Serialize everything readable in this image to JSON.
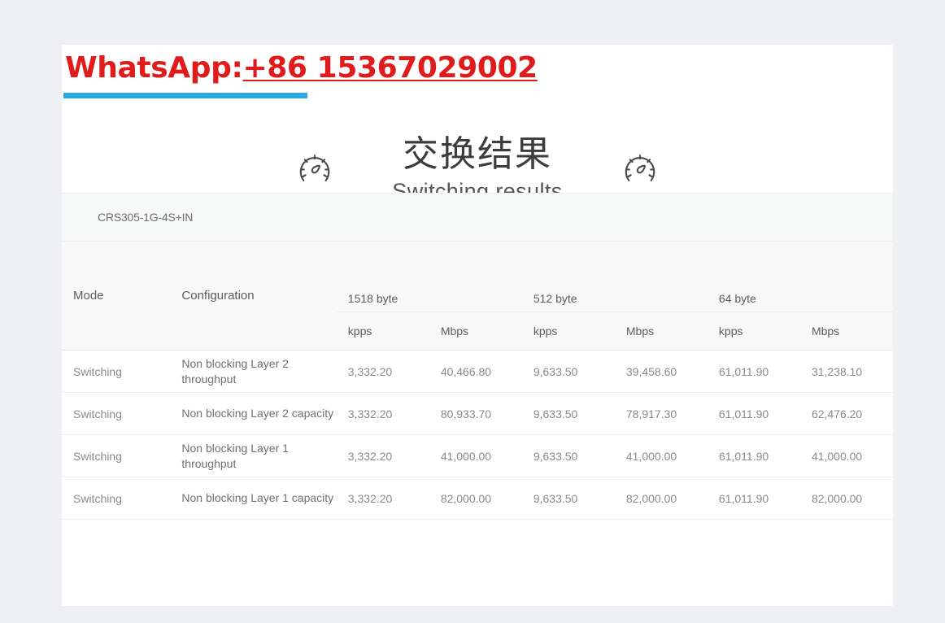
{
  "banner": {
    "label_prefix": "WhatsApp:",
    "phone": "+86 15367029002",
    "accent_color": "#29abe2",
    "text_color": "#e01b1b"
  },
  "header": {
    "title_cn": "交换结果",
    "title_en": "Switching results",
    "left_icon": "gauge-icon",
    "right_icon": "gauge-icon"
  },
  "model": {
    "name": "CRS305-1G-4S+IN"
  },
  "table": {
    "headers": {
      "mode": "Mode",
      "configuration": "Configuration",
      "groups": [
        {
          "label": "1518 byte",
          "units": [
            "kpps",
            "Mbps"
          ]
        },
        {
          "label": "512 byte",
          "units": [
            "kpps",
            "Mbps"
          ]
        },
        {
          "label": "64 byte",
          "units": [
            "kpps",
            "Mbps"
          ]
        }
      ]
    },
    "rows": [
      {
        "mode": "Switching",
        "configuration": "Non blocking Layer 2 throughput",
        "b1518_kpps": "3,332.20",
        "b1518_mbps": "40,466.80",
        "b512_kpps": "9,633.50",
        "b512_mbps": "39,458.60",
        "b64_kpps": "61,011.90",
        "b64_mbps": "31,238.10"
      },
      {
        "mode": "Switching",
        "configuration": "Non blocking Layer 2 capacity",
        "b1518_kpps": "3,332.20",
        "b1518_mbps": "80,933.70",
        "b512_kpps": "9,633.50",
        "b512_mbps": "78,917.30",
        "b64_kpps": "61,011.90",
        "b64_mbps": "62,476.20"
      },
      {
        "mode": "Switching",
        "configuration": "Non blocking Layer 1 throughput",
        "b1518_kpps": "3,332.20",
        "b1518_mbps": "41,000.00",
        "b512_kpps": "9,633.50",
        "b512_mbps": "41,000.00",
        "b64_kpps": "61,011.90",
        "b64_mbps": "41,000.00"
      },
      {
        "mode": "Switching",
        "configuration": "Non blocking Layer 1 capacity",
        "b1518_kpps": "3,332.20",
        "b1518_mbps": "82,000.00",
        "b512_kpps": "9,633.50",
        "b512_mbps": "82,000.00",
        "b64_kpps": "61,011.90",
        "b64_mbps": "82,000.00"
      }
    ]
  }
}
